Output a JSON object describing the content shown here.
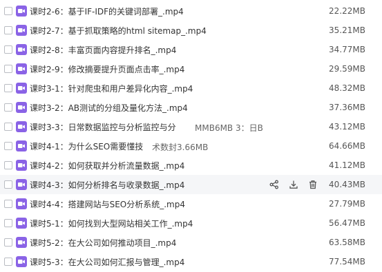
{
  "files": [
    {
      "name": "课时2-6：基于IF-IDF的关键词部署_.mp4",
      "size": "22.22MB"
    },
    {
      "name": "课时2-7：基于抓取策略的html sitemap_.mp4",
      "size": "35.21MB"
    },
    {
      "name": "课时2-8：丰富页面内容提升排名_.mp4",
      "size": "34.77MB"
    },
    {
      "name": "课时2-9：修改摘要提升页面点击率_.mp4",
      "size": "29.59MB"
    },
    {
      "name": "课时3-1：针对爬虫和用户差异化内容_.mp4",
      "size": "48.32MB"
    },
    {
      "name": "课时3-2：AB测试的分组及量化方法_.mp4",
      "size": "37.36MB"
    },
    {
      "name": "课时3-3：日常数据监控与分析监控与分",
      "size": "43.12MB"
    },
    {
      "name": "课时4-1：为什么SEO需要懂技",
      "size": "64.66MB"
    },
    {
      "name": "课时4-2：如何获取并分析流量数据_.mp4",
      "size": "41.12MB"
    },
    {
      "name": "课时4-3：如何分析排名与收录数据_.mp4",
      "size": "40.43MB"
    },
    {
      "name": "课时4-4：搭建网站与SEO分析系统_.mp4",
      "size": "27.79MB"
    },
    {
      "name": "课时5-1：如何找到大型网站相关工作_.mp4",
      "size": "56.47MB"
    },
    {
      "name": "课时5-2：在大公司如何推动项目_.mp4",
      "size": "63.58MB"
    },
    {
      "name": "课时5-3：在大公司如何汇报与管理_.mp4",
      "size": "77.54MB"
    }
  ],
  "overlay": {
    "line1": "MMB6MB 3：日B",
    "line2": "术数封3.66MB"
  },
  "hover_row_index": 9,
  "hover_actions": [
    "share-icon",
    "download-icon",
    "delete-icon"
  ],
  "colors": {
    "icon_bg": "#8a63e6",
    "hover_bg": "#f5f6f8"
  }
}
